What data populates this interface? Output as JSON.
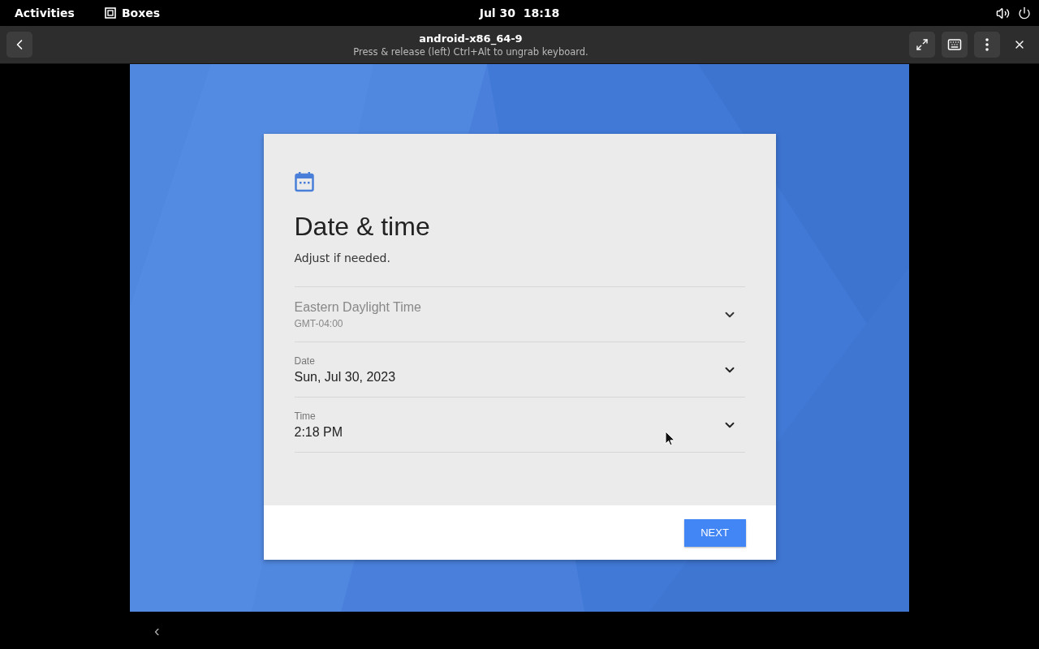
{
  "top_bar": {
    "activities": "Activities",
    "app": "Boxes",
    "clock": "Jul 30  18:18"
  },
  "header": {
    "title": "android-x86_64-9",
    "subtitle": "Press & release (left) Ctrl+Alt to ungrab keyboard."
  },
  "setup": {
    "title": "Date & time",
    "description": "Adjust if needed.",
    "rows": [
      {
        "kind": "zone",
        "title": "Eastern Daylight Time",
        "subtitle": "GMT-04:00",
        "disabled": true
      },
      {
        "kind": "field",
        "label": "Date",
        "value": "Sun, Jul 30, 2023",
        "disabled": false
      },
      {
        "kind": "field",
        "label": "Time",
        "value": "2:18 PM",
        "disabled": false
      }
    ],
    "button": "NEXT"
  },
  "nav": {
    "back": "‹"
  }
}
